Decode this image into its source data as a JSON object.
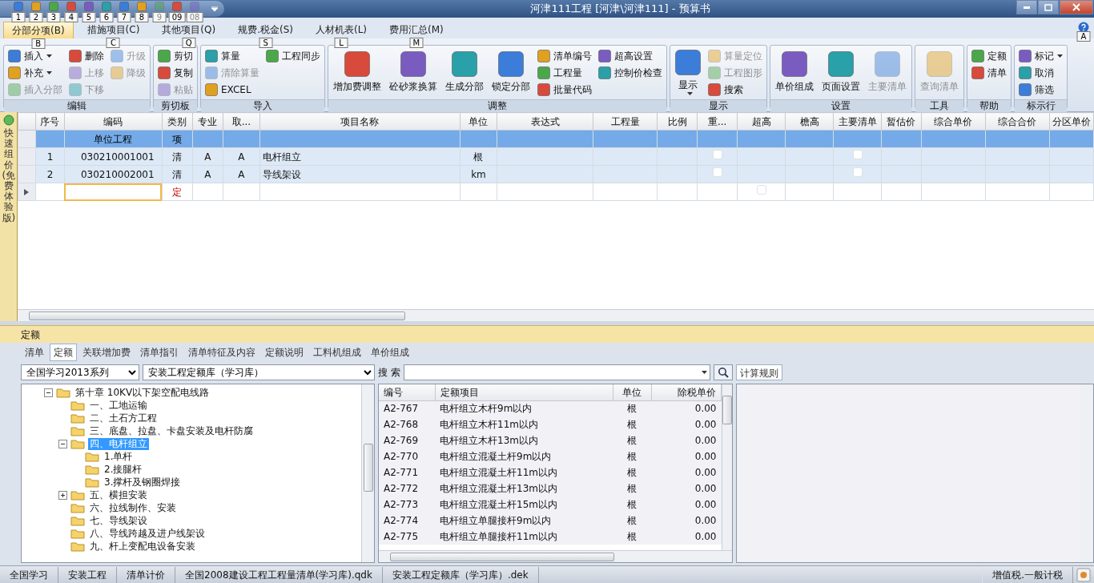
{
  "window": {
    "title": "河津111工程 [河津\\河津111] - 预算书"
  },
  "quick_access": [
    {
      "keytip": "1",
      "disabled": false
    },
    {
      "keytip": "2",
      "disabled": false
    },
    {
      "keytip": "3",
      "disabled": false
    },
    {
      "keytip": "4",
      "disabled": false
    },
    {
      "keytip": "5",
      "disabled": false
    },
    {
      "keytip": "6",
      "disabled": false
    },
    {
      "keytip": "7",
      "disabled": false
    },
    {
      "keytip": "8",
      "disabled": false
    },
    {
      "keytip": "9",
      "disabled": true
    },
    {
      "keytip": "09",
      "disabled": false
    },
    {
      "keytip": "08",
      "disabled": true
    }
  ],
  "ribbon_tabs": [
    {
      "label": "分部分项(B)",
      "keytip": "B",
      "selected": true
    },
    {
      "label": "措施项目(C)",
      "keytip": "C",
      "selected": false
    },
    {
      "label": "其他项目(Q)",
      "keytip": "Q",
      "selected": false
    },
    {
      "label": "规费.税金(S)",
      "keytip": "S",
      "selected": false
    },
    {
      "label": "人材机表(L)",
      "keytip": "L",
      "selected": false
    },
    {
      "label": "费用汇总(M)",
      "keytip": "M",
      "selected": false
    }
  ],
  "help_keytip": "A",
  "ribbon": {
    "groups": [
      {
        "label": "编辑",
        "items": [
          {
            "label": "插入",
            "kind": "small",
            "disabled": false,
            "dropdown": true
          },
          {
            "label": "补充",
            "kind": "small",
            "disabled": false,
            "dropdown": true
          },
          {
            "label": "插入分部",
            "kind": "small",
            "disabled": true
          },
          {
            "label": "删除",
            "kind": "small",
            "disabled": false
          },
          {
            "label": "上移",
            "kind": "small",
            "disabled": true
          },
          {
            "label": "下移",
            "kind": "small",
            "disabled": true
          },
          {
            "label": "升级",
            "kind": "small",
            "disabled": true
          },
          {
            "label": "降级",
            "kind": "small",
            "disabled": true
          }
        ]
      },
      {
        "label": "剪切板",
        "items": [
          {
            "label": "剪切",
            "kind": "small",
            "disabled": false
          },
          {
            "label": "复制",
            "kind": "small",
            "disabled": false
          },
          {
            "label": "粘贴",
            "kind": "small",
            "disabled": true
          }
        ]
      },
      {
        "label": "导入",
        "items": [
          {
            "label": "算量",
            "kind": "small",
            "disabled": false
          },
          {
            "label": "清除算量",
            "kind": "small",
            "disabled": true
          },
          {
            "label": "EXCEL",
            "kind": "small",
            "disabled": false
          },
          {
            "label": "工程同步",
            "kind": "small",
            "disabled": false
          }
        ]
      },
      {
        "label": "调整",
        "items": [
          {
            "label": "增加费调整",
            "kind": "large",
            "disabled": false
          },
          {
            "label": "砼砂浆换算",
            "kind": "large",
            "disabled": false
          },
          {
            "label": "生成分部",
            "kind": "large",
            "disabled": false
          },
          {
            "label": "锁定分部",
            "kind": "large",
            "disabled": false
          },
          {
            "label": "清单编号",
            "kind": "small",
            "disabled": false
          },
          {
            "label": "工程量",
            "kind": "small",
            "disabled": false
          },
          {
            "label": "批量代码",
            "kind": "small",
            "disabled": false
          },
          {
            "label": "超高设置",
            "kind": "small",
            "disabled": false
          },
          {
            "label": "控制价检查",
            "kind": "small",
            "disabled": false
          }
        ]
      },
      {
        "label": "显示",
        "items": [
          {
            "label": "显示",
            "kind": "large",
            "disabled": false,
            "dropdown": true
          },
          {
            "label": "算量定位",
            "kind": "small",
            "disabled": true
          },
          {
            "label": "工程图形",
            "kind": "small",
            "disabled": true
          },
          {
            "label": "搜索",
            "kind": "small",
            "disabled": false
          }
        ]
      },
      {
        "label": "设置",
        "items": [
          {
            "label": "单价组成",
            "kind": "large",
            "disabled": false
          },
          {
            "label": "页面设置",
            "kind": "large",
            "disabled": false
          },
          {
            "label": "主要清单",
            "kind": "large",
            "disabled": true
          }
        ]
      },
      {
        "label": "工具",
        "items": [
          {
            "label": "查询清单",
            "kind": "large",
            "disabled": true
          }
        ]
      },
      {
        "label": "帮助",
        "items": [
          {
            "label": "定额",
            "kind": "small",
            "disabled": false
          },
          {
            "label": "清单",
            "kind": "small",
            "disabled": false
          }
        ]
      },
      {
        "label": "标示行",
        "items": [
          {
            "label": "标记",
            "kind": "small",
            "disabled": false,
            "dropdown": true
          },
          {
            "label": "取消",
            "kind": "small",
            "disabled": false
          },
          {
            "label": "筛选",
            "kind": "small",
            "disabled": false
          }
        ]
      }
    ]
  },
  "side_tab": {
    "label": "快速组价(免费体验版)"
  },
  "grid": {
    "columns": [
      "序号",
      "编码",
      "类别",
      "专业",
      "取...",
      "项目名称",
      "单位",
      "表达式",
      "工程量",
      "比例",
      "重...",
      "超高",
      "檐高",
      "主要清单",
      "暂估价",
      "综合单价",
      "综合合价",
      "分区单价"
    ],
    "rows": [
      {
        "kind": "unit",
        "selected": true,
        "current": false,
        "column_2": "单位工程",
        "column_3": "项"
      },
      {
        "kind": "item",
        "selected": false,
        "current": false,
        "column_1": "1",
        "column_2": "030210001001",
        "column_3": "清",
        "column_4": "A",
        "column_5": "A",
        "column_6": "电杆组立",
        "column_7": "根",
        "column_11": {
          "checked": false
        },
        "column_14": {
          "checked": false
        }
      },
      {
        "kind": "item",
        "selected": false,
        "current": false,
        "column_1": "2",
        "column_2": "030210002001",
        "column_3": "清",
        "column_4": "A",
        "column_5": "A",
        "column_6": "导线架设",
        "column_7": "km",
        "column_11": {
          "checked": false
        },
        "column_14": {
          "checked": false
        }
      },
      {
        "kind": "new",
        "selected": false,
        "current": true,
        "column_3": "定",
        "column_12": {
          "checked": false
        }
      }
    ]
  },
  "bottom_panel": {
    "title": "定额",
    "tabs": [
      {
        "label": "清单",
        "selected": false
      },
      {
        "label": "定额",
        "selected": true
      },
      {
        "label": "关联增加费",
        "selected": false
      },
      {
        "label": "清单指引",
        "selected": false
      },
      {
        "label": "清单特征及内容",
        "selected": false
      },
      {
        "label": "定额说明",
        "selected": false
      },
      {
        "label": "工料机组成",
        "selected": false
      },
      {
        "label": "单价组成",
        "selected": false
      }
    ],
    "series_select": "全国学习2013系列",
    "library_select": "安装工程定额库（学习库）",
    "tree": [
      {
        "label": "第十章  10KV以下架空配电线路",
        "expanded": true,
        "selected": false,
        "children": [
          {
            "label": "一、工地运输",
            "selected": false
          },
          {
            "label": "二、土石方工程",
            "selected": false
          },
          {
            "label": "三、底盘、拉盘、卡盘安装及电杆防腐",
            "selected": false
          },
          {
            "label": "四、电杆组立",
            "expanded": true,
            "selected": true,
            "children": [
              {
                "label": "1.单杆",
                "selected": false
              },
              {
                "label": "2.接腿杆",
                "selected": false
              },
              {
                "label": "3.撑杆及钢圈焊接",
                "selected": false
              }
            ]
          },
          {
            "label": "五、横担安装",
            "expanded": false,
            "selected": false
          },
          {
            "label": "六、拉线制作、安装",
            "selected": false
          },
          {
            "label": "七、导线架设",
            "selected": false
          },
          {
            "label": "八、导线跨越及进户线架设",
            "selected": false
          },
          {
            "label": "九、杆上变配电设备安装",
            "selected": false
          }
        ]
      }
    ],
    "search_label": "搜 索",
    "quota_table": {
      "columns": [
        "编号",
        "定额项目",
        "单位",
        "除税单价"
      ],
      "rows": [
        [
          "A2-767",
          "电杆组立木杆9m以内",
          "根",
          "0.00"
        ],
        [
          "A2-768",
          "电杆组立木杆11m以内",
          "根",
          "0.00"
        ],
        [
          "A2-769",
          "电杆组立木杆13m以内",
          "根",
          "0.00"
        ],
        [
          "A2-770",
          "电杆组立混凝土杆9m以内",
          "根",
          "0.00"
        ],
        [
          "A2-771",
          "电杆组立混凝土杆11m以内",
          "根",
          "0.00"
        ],
        [
          "A2-772",
          "电杆组立混凝土杆13m以内",
          "根",
          "0.00"
        ],
        [
          "A2-773",
          "电杆组立混凝土杆15m以内",
          "根",
          "0.00"
        ],
        [
          "A2-774",
          "电杆组立单腿接杆9m以内",
          "根",
          "0.00"
        ],
        [
          "A2-775",
          "电杆组立单腿接杆11m以内",
          "根",
          "0.00"
        ]
      ]
    },
    "rules_tabs": [
      {
        "label": "计算规则",
        "selected": true
      }
    ]
  },
  "status_bar": {
    "items": [
      "全国学习",
      "安装工程",
      "清单计价",
      "全国2008建设工程工程量清单(学习库).qdk",
      "安装工程定额库（学习库）.dek"
    ],
    "tax_mode": "增值税.一般计税"
  }
}
